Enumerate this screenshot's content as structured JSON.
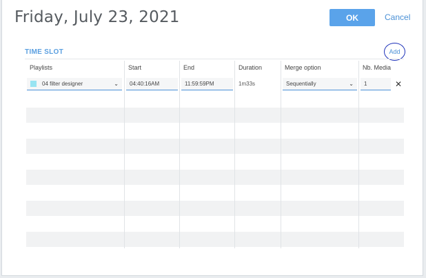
{
  "dialog": {
    "title": "Friday, July 23, 2021",
    "ok_label": "OK",
    "cancel_label": "Cancel"
  },
  "section": {
    "label": "TIME SLOT",
    "add_label": "Add"
  },
  "columns": [
    "Playlists",
    "Start",
    "End",
    "Duration",
    "Merge option",
    "Nb. Media"
  ],
  "row": {
    "playlist": "04 filter designer",
    "playlist_color": "#98e4f2",
    "start": "04:40:16AM",
    "end": "11:59:59PM",
    "duration": "1m33s",
    "merge_option": "Sequentially",
    "nb_media": "1",
    "remove_icon": "close-icon"
  },
  "colors": {
    "accent": "#5aa3ea",
    "link": "#4a90d6",
    "annotation_circle": "#1a2fb8"
  }
}
